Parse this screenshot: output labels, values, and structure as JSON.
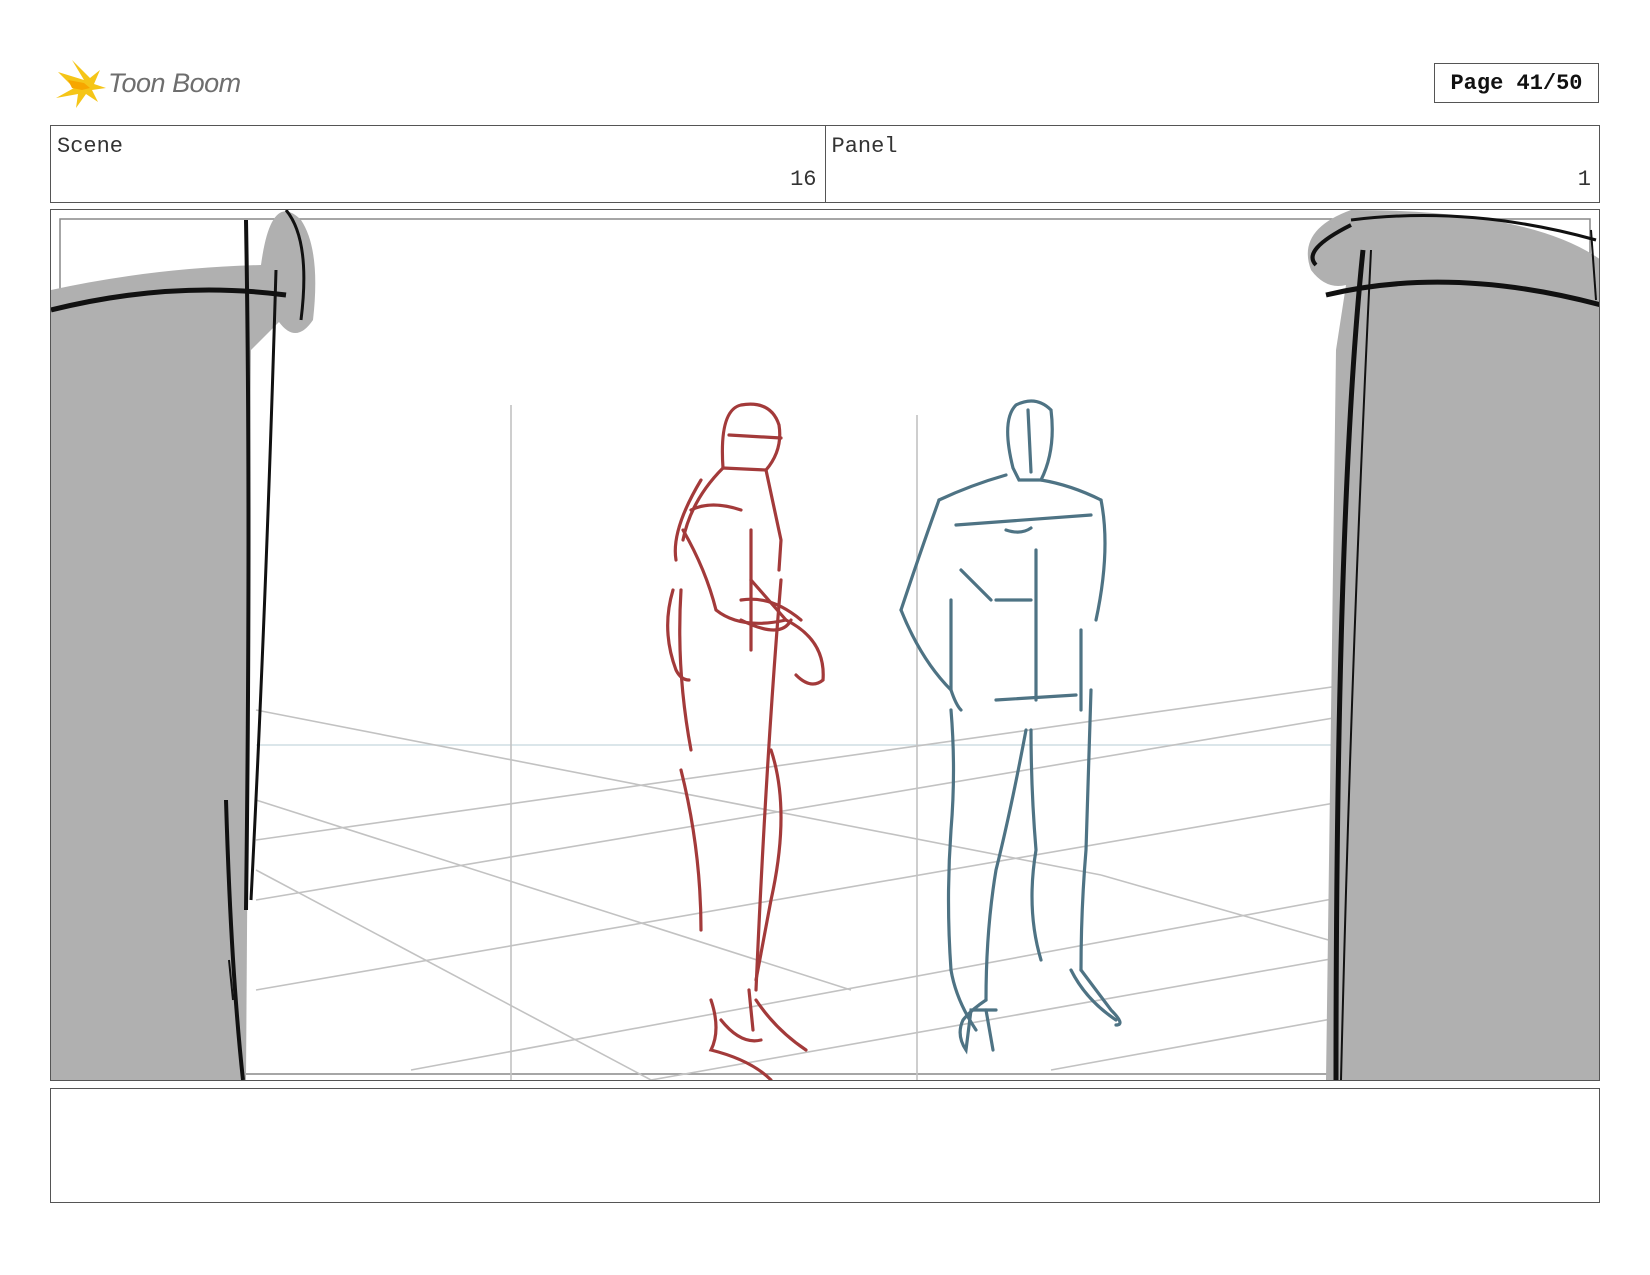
{
  "header": {
    "brand_name": "Toon Boom",
    "page_indicator": "Page 41/50"
  },
  "info": {
    "scene_label": "Scene",
    "scene_value": "16",
    "panel_label": "Panel",
    "panel_value": "1"
  },
  "notes": {
    "text": ""
  },
  "colors": {
    "frame_border": "#555555",
    "pillar_fill": "#b0b0b0",
    "figure_left": "#a33a3a",
    "figure_right": "#4e7384",
    "grid_lines": "#bdbdbd",
    "logo_accent": "#f5c518"
  },
  "icons": {
    "logo": "toon-boom-star-icon"
  }
}
